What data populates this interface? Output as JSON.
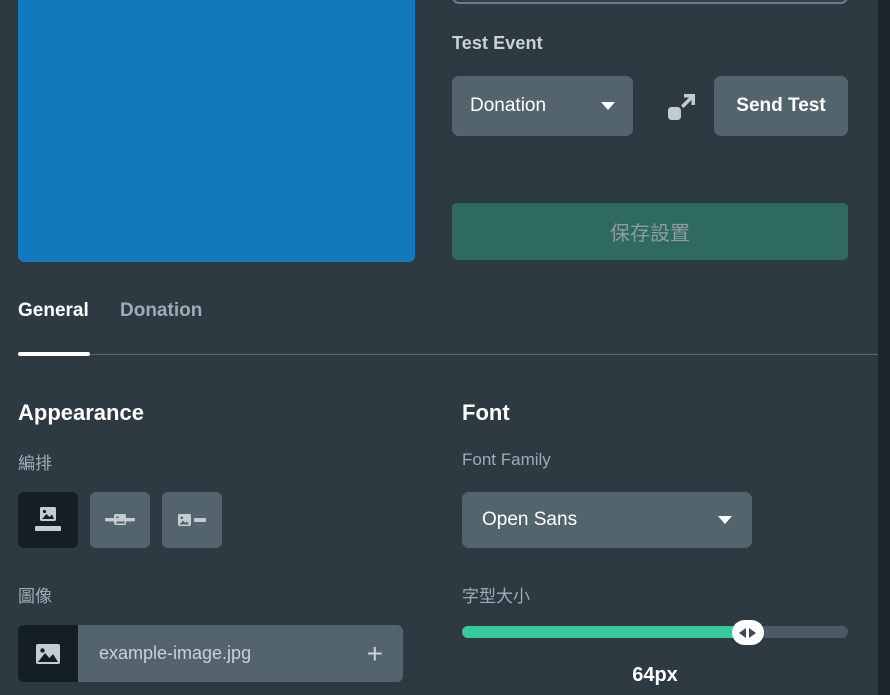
{
  "preview": {
    "name": "widget-preview",
    "background_color": "#1279bd"
  },
  "settings_panel": {
    "test_event": {
      "label": "Test Event",
      "event_select": {
        "value": "Donation",
        "icon": "chevron-down-icon"
      },
      "expand_icon": "expand-arrow-icon",
      "send_test_label": "Send Test"
    },
    "save_label": "保存設置"
  },
  "tabs": [
    {
      "label": "General",
      "active": true
    },
    {
      "label": "Donation",
      "active": false
    }
  ],
  "appearance": {
    "heading": "Appearance",
    "layout": {
      "label": "編排",
      "options": [
        {
          "name": "layout-image-top",
          "icon": "image-above-bar-icon",
          "selected": true
        },
        {
          "name": "layout-image-overlay",
          "icon": "image-over-bar-icon",
          "selected": false
        },
        {
          "name": "layout-image-left",
          "icon": "image-beside-bar-icon",
          "selected": false
        }
      ]
    },
    "image": {
      "label": "圖像",
      "thumb_icon": "image-icon",
      "file_name": "example-image.jpg",
      "add_icon": "plus-icon"
    }
  },
  "font": {
    "heading": "Font",
    "family": {
      "label": "Font Family",
      "value": "Open Sans",
      "icon": "chevron-down-icon"
    },
    "size": {
      "label": "字型大小",
      "value_text": "64px",
      "percent": 74,
      "fill_color": "#37c89b",
      "track_color": "#4b5b65"
    }
  }
}
